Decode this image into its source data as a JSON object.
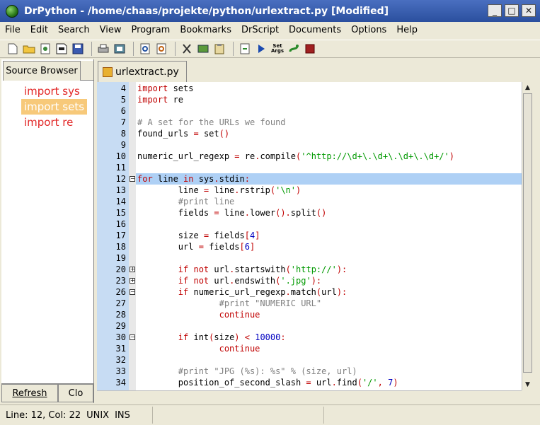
{
  "window": {
    "title": "DrPython - /home/chaas/projekte/python/urlextract.py [Modified]",
    "controls": [
      "_",
      "□",
      "✕"
    ]
  },
  "menu": [
    "File",
    "Edit",
    "Search",
    "View",
    "Program",
    "Bookmarks",
    "DrScript",
    "Documents",
    "Options",
    "Help"
  ],
  "toolbar": [
    "new-file",
    "open",
    "reload",
    "save-as",
    "save",
    "print",
    "print-preview",
    "find",
    "replace",
    "cut",
    "copy",
    "paste",
    "clear",
    "run",
    "set-args",
    "python",
    "stop"
  ],
  "toolbar_set_args_label": "Set\nArgs",
  "sidebar": {
    "tab": "Source Browser",
    "items": [
      {
        "label": "import sys",
        "selected": false
      },
      {
        "label": "import sets",
        "selected": true
      },
      {
        "label": "import re",
        "selected": false
      }
    ],
    "refresh": "Refresh",
    "close": "Clo"
  },
  "editor": {
    "tab": "urlextract.py",
    "lines": [
      {
        "n": "4",
        "fold": "",
        "hl": false,
        "html": "<span class=\"kw\">import</span> sets"
      },
      {
        "n": "5",
        "fold": "",
        "hl": false,
        "html": "<span class=\"kw\">import</span> re"
      },
      {
        "n": "6",
        "fold": "",
        "hl": false,
        "html": ""
      },
      {
        "n": "7",
        "fold": "",
        "hl": false,
        "html": "<span class=\"cmt\"># A set for the URLs we found</span>"
      },
      {
        "n": "8",
        "fold": "",
        "hl": false,
        "html": "found_urls <span class=\"op\">=</span> set<span class=\"op\">()</span>"
      },
      {
        "n": "9",
        "fold": "",
        "hl": false,
        "html": ""
      },
      {
        "n": "10",
        "fold": "",
        "hl": false,
        "html": "numeric_url_regexp <span class=\"op\">=</span> re<span class=\"op\">.</span>compile<span class=\"op\">(</span><span class=\"str\">'^http://\\d+\\.\\d+\\.\\d+\\.\\d+/'</span><span class=\"op\">)</span>"
      },
      {
        "n": "11",
        "fold": "",
        "hl": false,
        "html": ""
      },
      {
        "n": "12",
        "fold": "minus",
        "hl": true,
        "html": "<span class=\"kw\">for</span> line <span class=\"kw\">in</span> sys<span class=\"op\">.</span>stdin<span class=\"op\">:</span>"
      },
      {
        "n": "13",
        "fold": "",
        "hl": false,
        "html": "        line <span class=\"op\">=</span> line<span class=\"op\">.</span>rstrip<span class=\"op\">(</span><span class=\"str\">'\\n'</span><span class=\"op\">)</span>"
      },
      {
        "n": "14",
        "fold": "",
        "hl": false,
        "html": "        <span class=\"cmt\">#print line</span>"
      },
      {
        "n": "15",
        "fold": "",
        "hl": false,
        "html": "        fields <span class=\"op\">=</span> line<span class=\"op\">.</span>lower<span class=\"op\">().</span>split<span class=\"op\">()</span>"
      },
      {
        "n": "16",
        "fold": "",
        "hl": false,
        "html": ""
      },
      {
        "n": "17",
        "fold": "",
        "hl": false,
        "html": "        size <span class=\"op\">=</span> fields<span class=\"op\">[</span><span class=\"num\">4</span><span class=\"op\">]</span>"
      },
      {
        "n": "18",
        "fold": "",
        "hl": false,
        "html": "        url <span class=\"op\">=</span> fields<span class=\"op\">[</span><span class=\"num\">6</span><span class=\"op\">]</span>"
      },
      {
        "n": "19",
        "fold": "",
        "hl": false,
        "html": ""
      },
      {
        "n": "20",
        "fold": "plus",
        "hl": false,
        "html": "        <span class=\"kw\">if</span> <span class=\"kw\">not</span> url<span class=\"op\">.</span>startswith<span class=\"op\">(</span><span class=\"str\">'http://'</span><span class=\"op\">):</span>"
      },
      {
        "n": "23",
        "fold": "plus",
        "hl": false,
        "html": "        <span class=\"kw\">if</span> <span class=\"kw\">not</span> url<span class=\"op\">.</span>endswith<span class=\"op\">(</span><span class=\"str\">'.jpg'</span><span class=\"op\">):</span>"
      },
      {
        "n": "26",
        "fold": "minus",
        "hl": false,
        "html": "        <span class=\"kw\">if</span> numeric_url_regexp<span class=\"op\">.</span>match<span class=\"op\">(</span>url<span class=\"op\">):</span>"
      },
      {
        "n": "27",
        "fold": "",
        "hl": false,
        "html": "                <span class=\"cmt\">#print \"NUMERIC URL\"</span>"
      },
      {
        "n": "28",
        "fold": "",
        "hl": false,
        "html": "                <span class=\"kw\">continue</span>"
      },
      {
        "n": "29",
        "fold": "",
        "hl": false,
        "html": ""
      },
      {
        "n": "30",
        "fold": "minus",
        "hl": false,
        "html": "        <span class=\"kw\">if</span> int<span class=\"op\">(</span>size<span class=\"op\">)</span> <span class=\"op\">&lt;</span> <span class=\"num\">10000</span><span class=\"op\">:</span>"
      },
      {
        "n": "31",
        "fold": "",
        "hl": false,
        "html": "                <span class=\"kw\">continue</span>"
      },
      {
        "n": "32",
        "fold": "",
        "hl": false,
        "html": ""
      },
      {
        "n": "33",
        "fold": "",
        "hl": false,
        "html": "        <span class=\"cmt\">#print \"JPG (%s): %s\" % (size, url)</span>"
      },
      {
        "n": "34",
        "fold": "",
        "hl": false,
        "html": "        position_of_second_slash <span class=\"op\">=</span> url<span class=\"op\">.</span>find<span class=\"op\">(</span><span class=\"str\">'/'</span><span class=\"op\">,</span> <span class=\"num\">7</span><span class=\"op\">)</span>"
      }
    ]
  },
  "status": {
    "position": "Line: 12, Col: 22",
    "eol": "UNIX",
    "mode": "INS"
  }
}
